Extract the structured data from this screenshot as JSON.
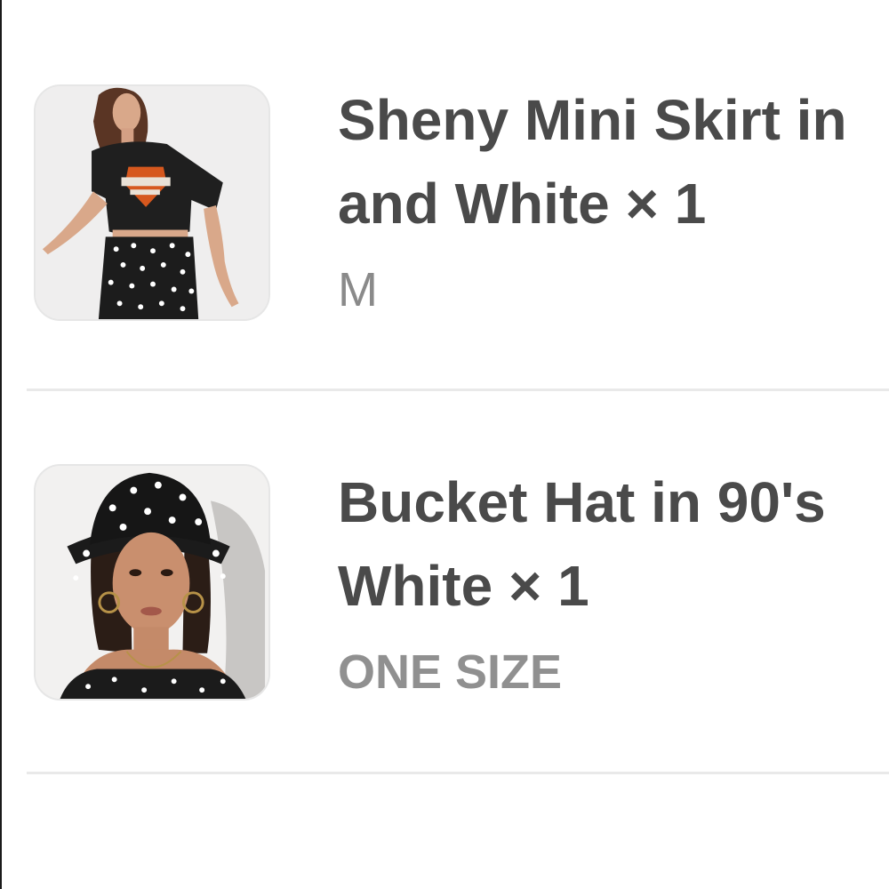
{
  "order_items": [
    {
      "title_line1": "Sheny Mini Skirt in",
      "title_line2": "and White × 1",
      "variant": "M",
      "thumbnail_icon": "product-photo-model-skirt"
    },
    {
      "title_line1": "Bucket Hat in 90's",
      "title_line2": "White × 1",
      "variant": "ONE SIZE",
      "thumbnail_icon": "product-photo-model-bucket-hat"
    }
  ],
  "colors": {
    "title": "#4a4a4a",
    "variant": "#8a8a8a",
    "divider": "#e9e9e9",
    "thumb_border": "#e6e6e6"
  }
}
